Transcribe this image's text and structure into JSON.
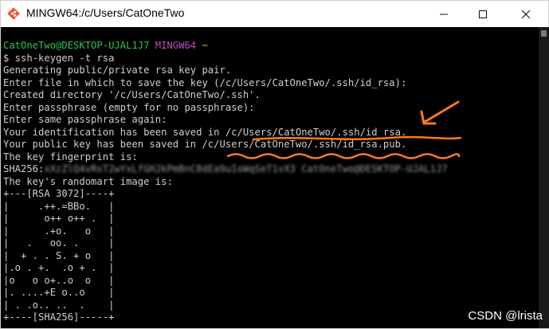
{
  "window": {
    "title": "MINGW64:/c/Users/CatOneTwo",
    "minimize_glyph": "—",
    "close_glyph": "✕",
    "accent": "#ff7a1a"
  },
  "prompt": {
    "user_host": "CatOneTwo@DESKTOP-UJAL1J7",
    "shell": "MINGW64",
    "path": "~"
  },
  "terminal": {
    "command": "$ ssh-keygen -t rsa",
    "lines": [
      "Generating public/private rsa key pair.",
      "Enter file in which to save the key (/c/Users/CatOneTwo/.ssh/id_rsa):",
      "Created directory '/c/Users/CatOneTwo/.ssh'.",
      "Enter passphrase (empty for no passphrase):",
      "Enter same passphrase again:",
      "Your identification has been saved in /c/Users/CatOneTwo/.ssh/id_rsa.",
      "Your public key has been saved in /c/Users/CatOneTwo/.ssh/id_rsa.pub.",
      "The key fingerprint is:"
    ],
    "fingerprint_prefix": "SHA256:",
    "randomart_heading": "The key's randomart image is:",
    "randomart": [
      "+---[RSA 3072]----+",
      "|     .++.=BBo.   |",
      "|      o++ o++ .  |",
      "|      .+o.   o   |",
      "|   .   oo. .     |",
      "|  + . . S. + o   |",
      "|.o . +.  .o + .  |",
      "|o   o o+..o  o   |",
      "|. ....+E o..o    |",
      "| . .o.. ..  .    |",
      "+----[SHA256]-----+"
    ]
  },
  "watermark": "CSDN @lrista"
}
